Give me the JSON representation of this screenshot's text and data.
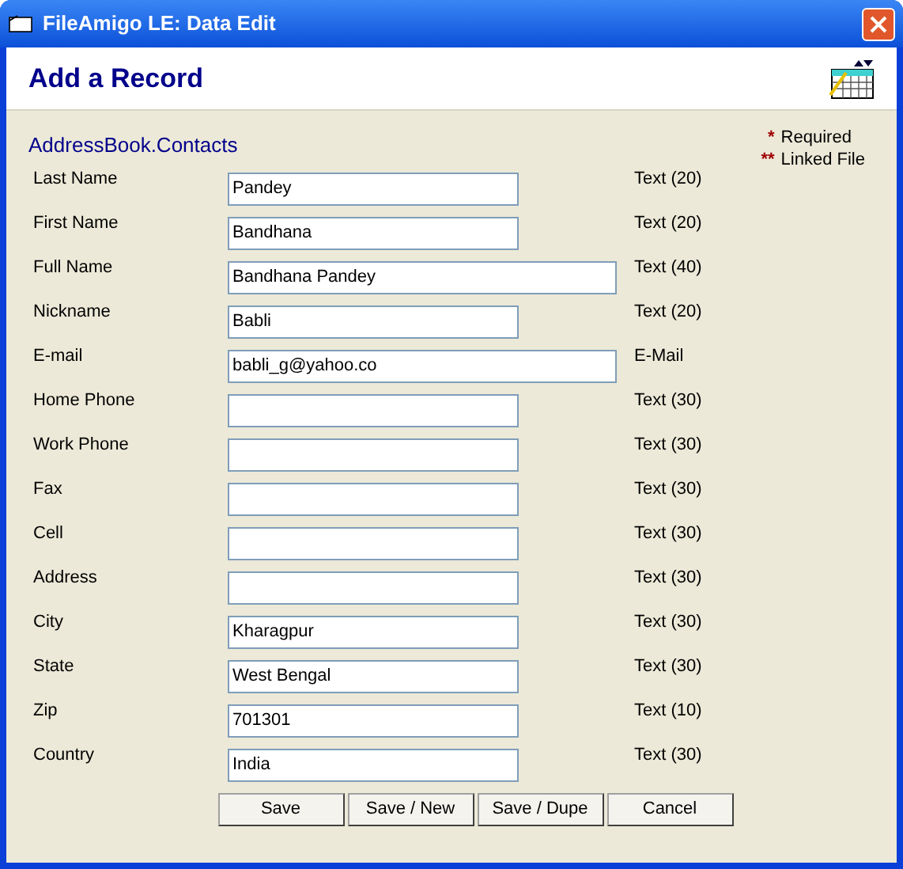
{
  "window": {
    "title": "FileAmigo LE: Data Edit"
  },
  "header": {
    "title": "Add a Record"
  },
  "table_name": "AddressBook.Contacts",
  "legend": [
    {
      "mark": "*",
      "label": "Required"
    },
    {
      "mark": "**",
      "label": "Linked File"
    }
  ],
  "fields": [
    {
      "label": "Last Name",
      "value": "Pandey",
      "kind": "short",
      "type": "Text (20)"
    },
    {
      "label": "First Name",
      "value": "Bandhana",
      "kind": "short",
      "type": "Text (20)"
    },
    {
      "label": "Full Name",
      "value": "Bandhana Pandey",
      "kind": "long",
      "type": "Text (40)"
    },
    {
      "label": "Nickname",
      "value": "Babli",
      "kind": "short",
      "type": "Text (20)"
    },
    {
      "label": "E-mail",
      "value": "babli_g@yahoo.co",
      "kind": "long",
      "type": "E-Mail"
    },
    {
      "label": "Home Phone",
      "kind": "short",
      "type": "Text (30)"
    },
    {
      "label": "Work Phone",
      "kind": "short",
      "type": "Text (30)"
    },
    {
      "label": "Fax",
      "kind": "short",
      "type": "Text (30)"
    },
    {
      "label": "Cell",
      "kind": "short",
      "type": "Text (30)"
    },
    {
      "label": "Address",
      "kind": "short",
      "type": "Text (30)"
    },
    {
      "label": "City",
      "value": "Kharagpur",
      "kind": "short",
      "type": "Text (30)"
    },
    {
      "label": "State",
      "value": "West Bengal",
      "kind": "short",
      "type": "Text (30)"
    },
    {
      "label": "Zip",
      "value": "701301",
      "kind": "short",
      "type": "Text (10)"
    },
    {
      "label": "Country",
      "value": "India",
      "kind": "short",
      "type": "Text (30)"
    }
  ],
  "buttons": [
    "Save",
    "Save / New",
    "Save / Dupe",
    "Cancel"
  ]
}
